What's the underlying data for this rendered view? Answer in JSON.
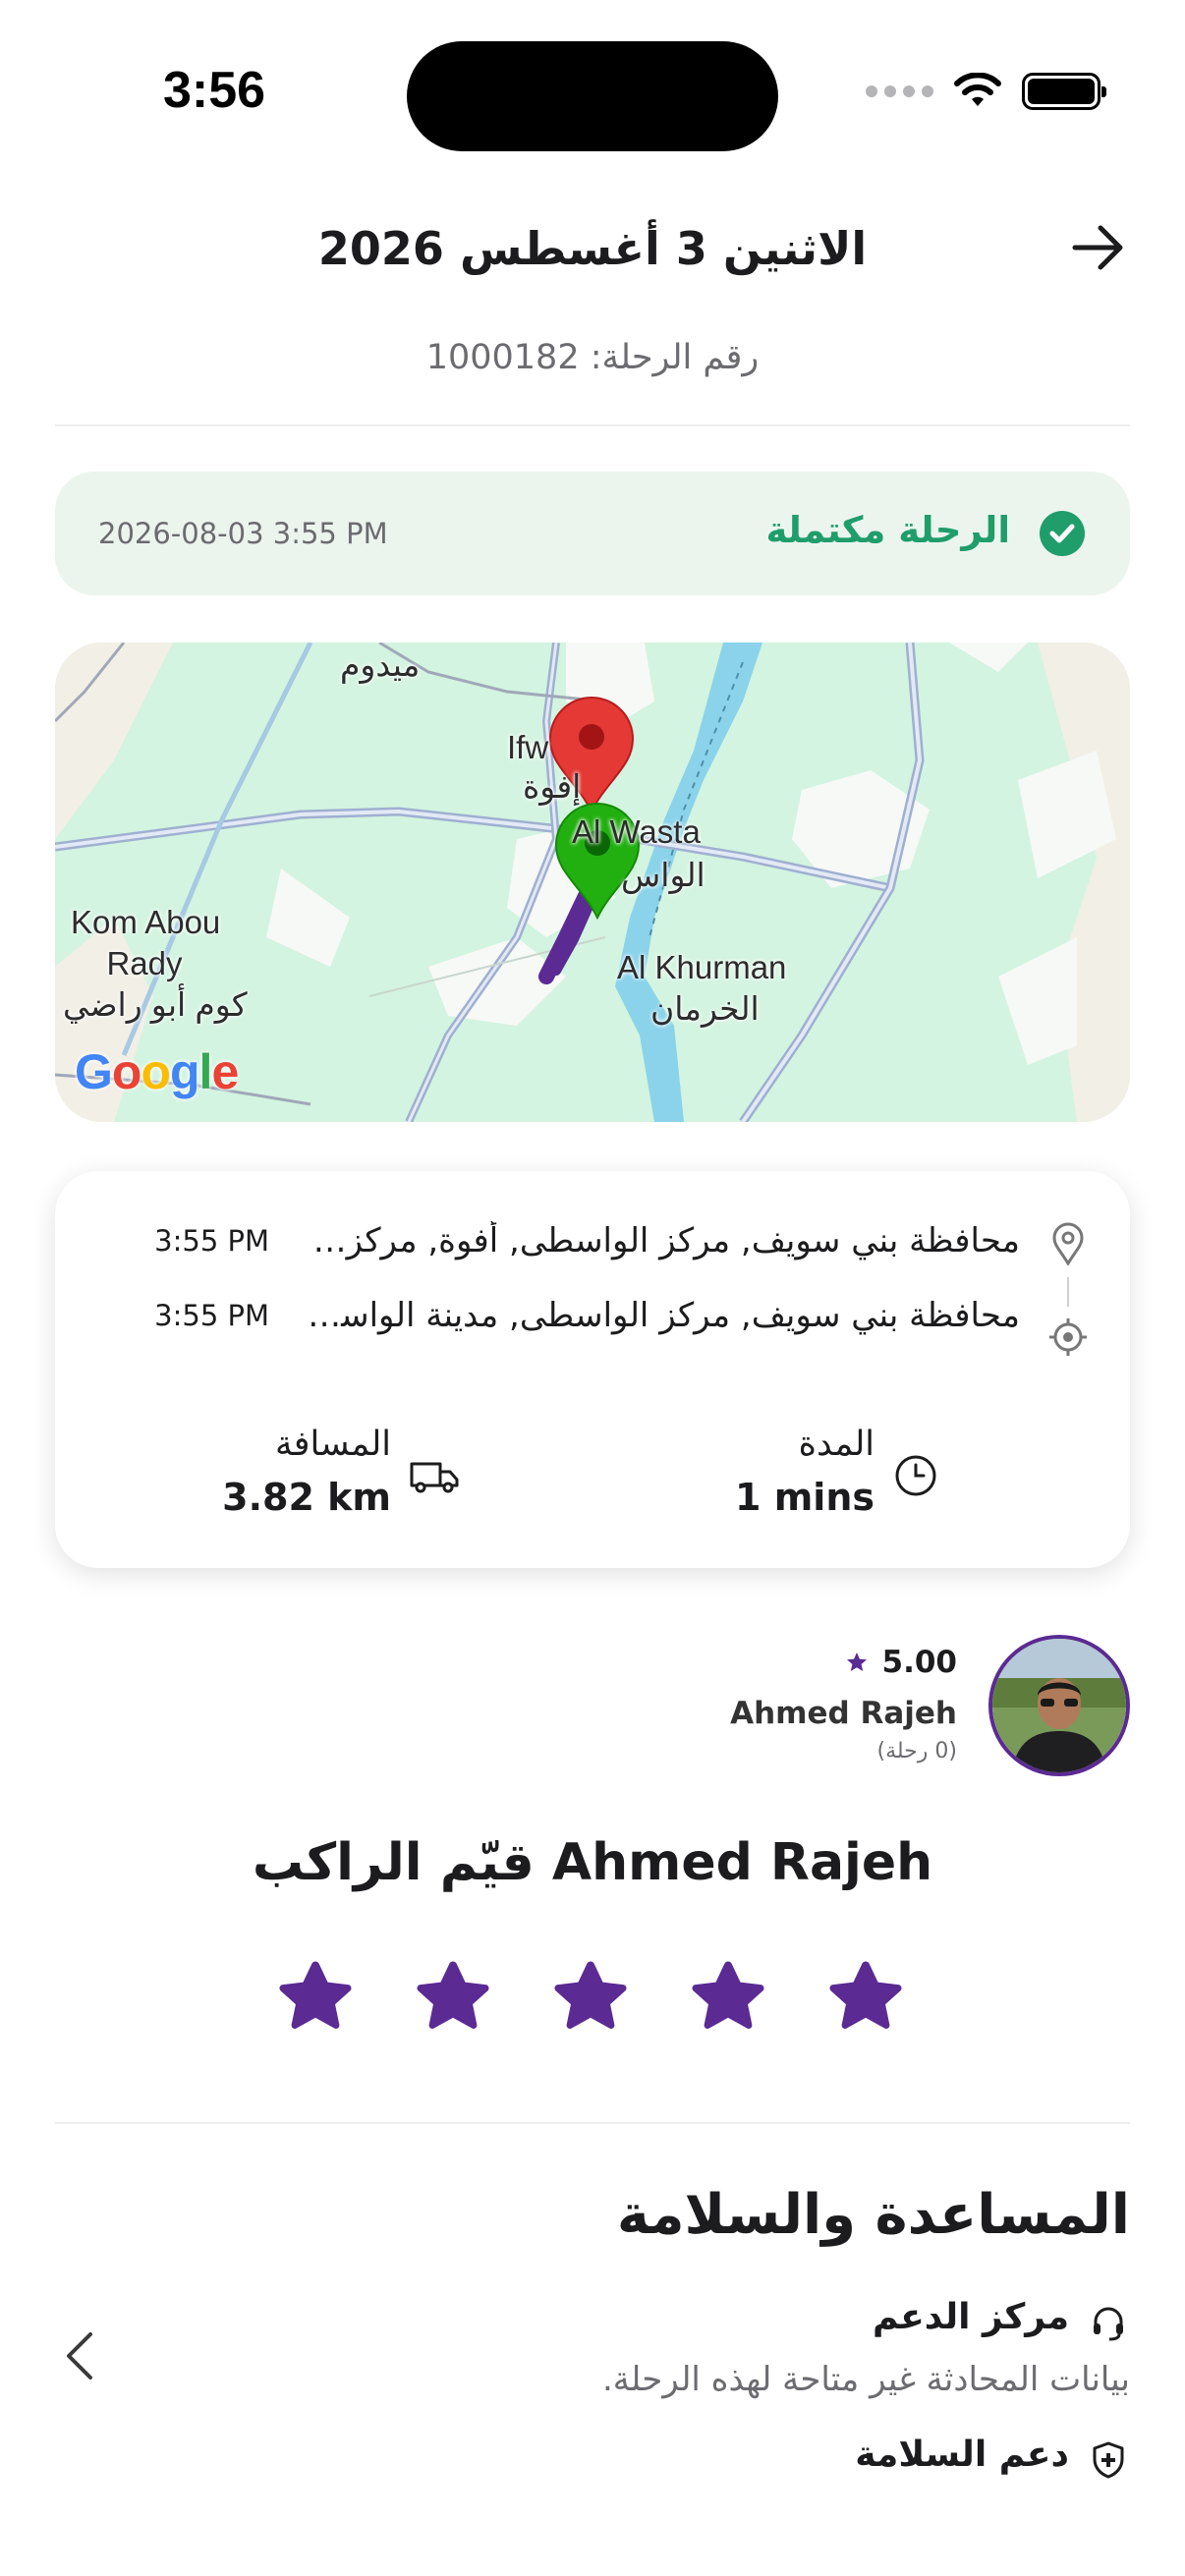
{
  "status_bar": {
    "time": "3:56"
  },
  "header": {
    "title": "الاثنين 3 أغسطس 2026",
    "trip_number": "رقم الرحلة: 1000182"
  },
  "trip_status": {
    "label": "الرحلة مكتملة",
    "timestamp": "2026-08-03 3:55 PM",
    "color": "#1f9d6a"
  },
  "map": {
    "labels": {
      "meidoum": "ميدوم",
      "ifwa_en": "Ifw",
      "ifwa_ar": "إفوة",
      "al_wasta_en": "Al Wasta",
      "al_wasta_ar": "الواس",
      "kom_abou_en_1": "Kom Abou",
      "kom_abou_en_2": "Rady",
      "kom_abou_ar": "كوم أبو راضي",
      "khurman_en": "Al Khurman",
      "khurman_ar": "الخرمان"
    },
    "logo_letters": [
      "G",
      "o",
      "o",
      "g",
      "l",
      "e"
    ]
  },
  "route": {
    "pickup": {
      "address": "محافظة بني سويف, مركز الواسطى, أفوة, مركز الواسطى",
      "time": "3:55 PM",
      "icon": "location-pin-icon"
    },
    "dropoff": {
      "address": "محافظة بني سويف, مركز الواسطى, مدينة الواسطى",
      "time": "3:55 PM",
      "icon": "target-icon"
    }
  },
  "stats": {
    "duration_label": "المدة",
    "duration_value": "1 mins",
    "distance_label": "المسافة",
    "distance_value": "3.82 km"
  },
  "rider": {
    "rating": "5.00",
    "name": "Ahmed Rajeh",
    "trips": "(0 رحلة)"
  },
  "rate_section": {
    "title": "قيّم الراكب Ahmed Rajeh",
    "star_count": 5,
    "star_color": "#5b2a93"
  },
  "help": {
    "title": "المساعدة والسلامة",
    "support_center": "مركز الدعم",
    "chat_unavailable": "بيانات المحادثة غير متاحة لهذه الرحلة.",
    "safety_support": "دعم السلامة"
  }
}
